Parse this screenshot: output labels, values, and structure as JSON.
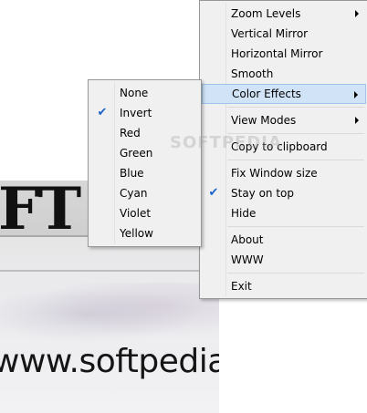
{
  "background": {
    "big_text": "FT",
    "url_text": "www.softpedia.",
    "watermark": "SOFTPEDIA"
  },
  "main_menu": {
    "items": [
      {
        "label": "Zoom Levels",
        "submenu": true
      },
      {
        "label": "Vertical Mirror"
      },
      {
        "label": "Horizontal Mirror"
      },
      {
        "label": "Smooth"
      },
      {
        "label": "Color Effects",
        "submenu": true,
        "highlighted": true
      },
      {
        "label": "View Modes",
        "submenu": true
      },
      {
        "label": "Copy to clipboard"
      },
      {
        "label": "Fix Window size"
      },
      {
        "label": "Stay on top",
        "checked": true
      },
      {
        "label": "Hide"
      },
      {
        "label": "About"
      },
      {
        "label": "WWW"
      },
      {
        "label": "Exit"
      }
    ]
  },
  "color_effects_menu": {
    "items": [
      {
        "label": "None"
      },
      {
        "label": "Invert",
        "checked": true
      },
      {
        "label": "Red"
      },
      {
        "label": "Green"
      },
      {
        "label": "Blue"
      },
      {
        "label": "Cyan"
      },
      {
        "label": "Violet"
      },
      {
        "label": "Yellow"
      }
    ]
  },
  "colors": {
    "menu_bg": "#f0f0f0",
    "highlight_bg": "#d1e3f7",
    "highlight_border": "#9fc4ec",
    "check": "#1a64c8"
  },
  "icons": {
    "check": "checkmark-icon",
    "submenu": "submenu-arrow-icon"
  }
}
